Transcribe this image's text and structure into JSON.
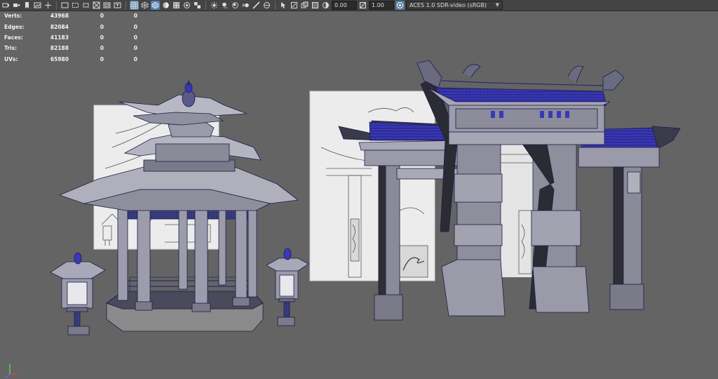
{
  "toolbar": {
    "icons": [
      "select-camera-icon",
      "camera-attributes-icon",
      "bookmark-icon",
      "image-plane-icon",
      "grid-2d-pan-icon",
      "film-gate-icon",
      "resolution-gate-icon",
      "gate-mask-icon",
      "field-chart-icon",
      "safe-action-icon",
      "safe-title-icon",
      "grid-icon",
      "wireframe-icon",
      "smooth-shade-icon",
      "default-material-icon",
      "wireframe-on-shaded-icon",
      "xray-icon",
      "textures-icon",
      "lights-icon",
      "shadows-icon",
      "screen-space-ao-icon",
      "motion-blur-icon",
      "anti-aliasing-icon",
      "depth-of-field-icon",
      "isolate-select-icon",
      "xray-joints-icon",
      "xray-active-icon",
      "backface-culling-icon",
      "color-management-icon"
    ],
    "exposure_value": "0.00",
    "gamma_value": "1.00",
    "color_space": "ACES 1.0 SDR-video (sRGB)",
    "colors": {
      "bar": "#444444",
      "active": "#5a7da3"
    }
  },
  "hud": {
    "rows": [
      {
        "label": "Verts:",
        "values": [
          "43968",
          "0",
          "0"
        ]
      },
      {
        "label": "Edges:",
        "values": [
          "82084",
          "0",
          "0"
        ]
      },
      {
        "label": "Faces:",
        "values": [
          "41183",
          "0",
          "0"
        ]
      },
      {
        "label": "Tris:",
        "values": [
          "82188",
          "0",
          "0"
        ]
      },
      {
        "label": "UVs:",
        "values": [
          "65980",
          "0",
          "0"
        ]
      }
    ]
  },
  "viewport": {
    "background": "#646464",
    "wire_color": "#2a2a6a",
    "selected_color": "#3a38b8"
  }
}
